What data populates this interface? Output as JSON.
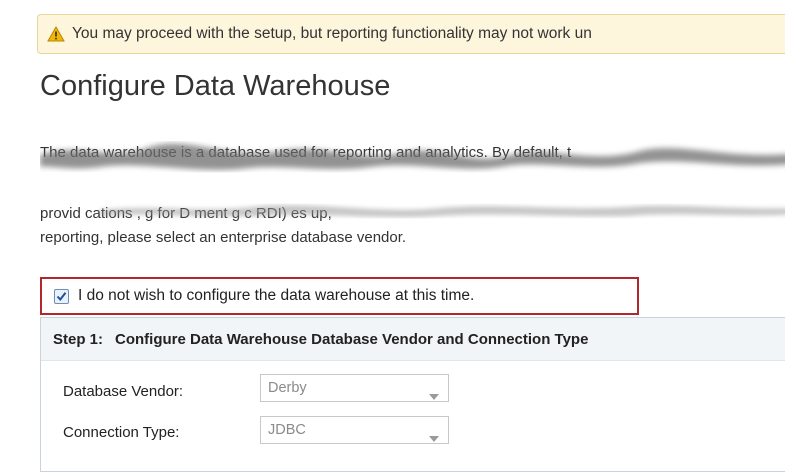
{
  "warning": {
    "icon": "warning-triangle-icon",
    "text": "You may proceed with the setup, but reporting functionality may not work un"
  },
  "page_title": "Configure Data Warehouse",
  "description": {
    "line1": "The data warehouse is a database used for reporting and analytics. By default, t",
    "line2": "provid    cations     ,    g for D      ment        g    c     RDI)    es      up,",
    "line3": "reporting, please select an enterprise database vendor."
  },
  "skip_checkbox": {
    "checked": true,
    "label": "I do not wish to configure the data warehouse at this time."
  },
  "step1": {
    "label": "Step 1:",
    "title": "Configure Data Warehouse Database Vendor and Connection Type",
    "vendor_label": "Database Vendor:",
    "vendor_value": "Derby",
    "connection_label": "Connection Type:",
    "connection_value": "JDBC"
  },
  "colors": {
    "highlight_border": "#b3262b",
    "warning_bg": "#fdf6dc"
  }
}
